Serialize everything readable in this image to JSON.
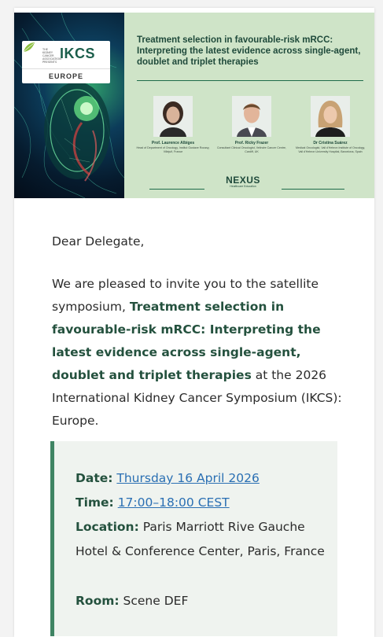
{
  "banner": {
    "ikcs_subtitle": "THE KIDNEY CANCER ASSOCIATION PRESENTS",
    "ikcs_title": "IKCS",
    "ikcs_region": "EUROPE",
    "title": "Treatment selection in favourable-risk mRCC: Interpreting the latest evidence across single-agent, doublet and triplet therapies",
    "speakers": [
      {
        "name": "Prof. Laurence Albiges",
        "role": "Head of Department of Oncology, Institut Gustave Roussy, Villejuif, France"
      },
      {
        "name": "Prof. Ricky Frazer",
        "role": "Consultant Clinical Oncologist, Velindre Cancer Centre, Cardiff, UK"
      },
      {
        "name": "Dr Cristina Suárez",
        "role": "Medical Oncologist, Vall d'Hebron Institute of Oncology, Vall d'Hebron University Hospital, Barcelona, Spain"
      }
    ],
    "sponsor_name": "NEXUS",
    "sponsor_sub": "Healthcare Education"
  },
  "email": {
    "greeting": "Dear Delegate,",
    "intro_before": "We are pleased to invite you to the satellite symposium, ",
    "intro_bold": "Treatment selection in favourable-risk mRCC: Interpreting the latest evidence across single-agent, doublet and triplet therapies",
    "intro_after": " at the 2026 International Kidney Cancer Symposium (IKCS): Europe."
  },
  "details": {
    "date_label": "Date:",
    "date_value": "Thursday 16 April 2026",
    "time_label": "Time:",
    "time_value": "17:00–18:00 CEST",
    "location_label": "Location:",
    "location_value": "Paris Marriott Rive Gauche Hotel & Conference Center, Paris, France",
    "room_label": "Room:",
    "room_value": "Scene DEF"
  },
  "colors": {
    "banner_bg": "#cfe4c8",
    "heading_green": "#24513e",
    "accent_bar": "#3f8463",
    "link_blue": "#2a6fb3"
  }
}
